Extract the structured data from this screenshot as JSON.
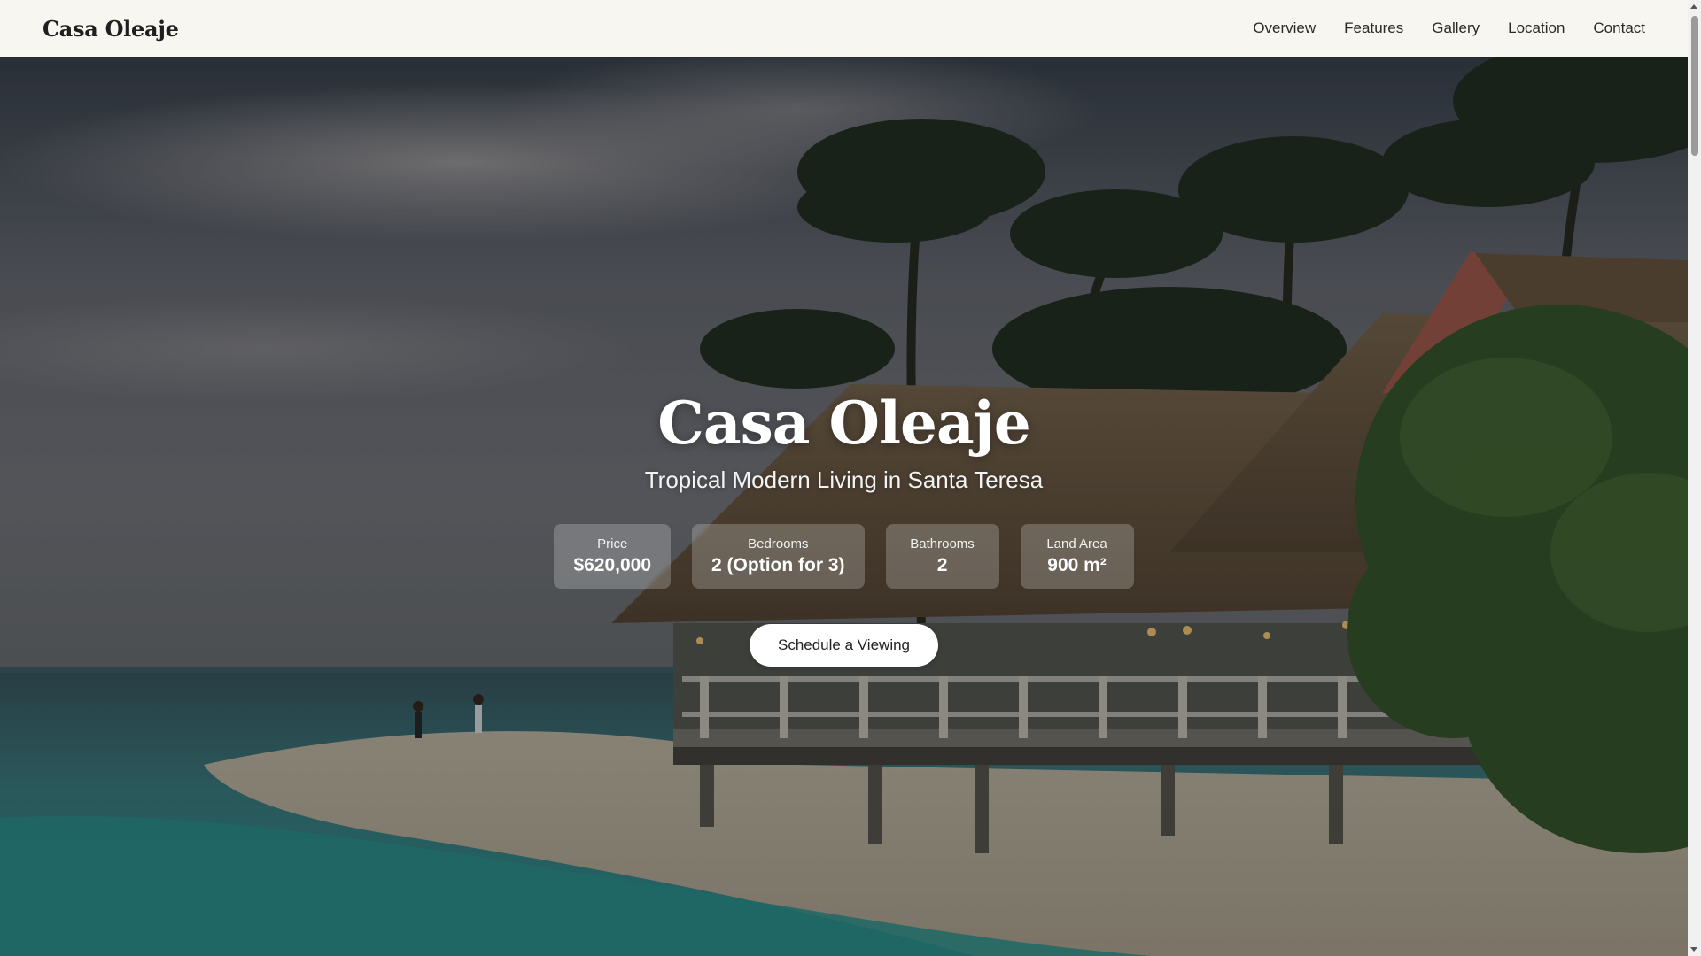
{
  "brand": "Casa Oleaje",
  "nav": {
    "items": [
      {
        "label": "Overview"
      },
      {
        "label": "Features"
      },
      {
        "label": "Gallery"
      },
      {
        "label": "Location"
      },
      {
        "label": "Contact"
      }
    ]
  },
  "hero": {
    "title": "Casa Oleaje",
    "subtitle": "Tropical Modern Living in Santa Teresa",
    "stats": [
      {
        "label": "Price",
        "value": "$620,000"
      },
      {
        "label": "Bedrooms",
        "value": "2 (Option for 3)"
      },
      {
        "label": "Bathrooms",
        "value": "2"
      },
      {
        "label": "Land Area",
        "value": "900 m²"
      }
    ],
    "cta_label": "Schedule a Viewing",
    "background_image": "tropical-beach-villa-photo"
  },
  "colors": {
    "nav_background": "#f8f6f1",
    "hero_text": "#ffffff",
    "cta_background": "#ffffff",
    "cta_text": "#222222"
  }
}
